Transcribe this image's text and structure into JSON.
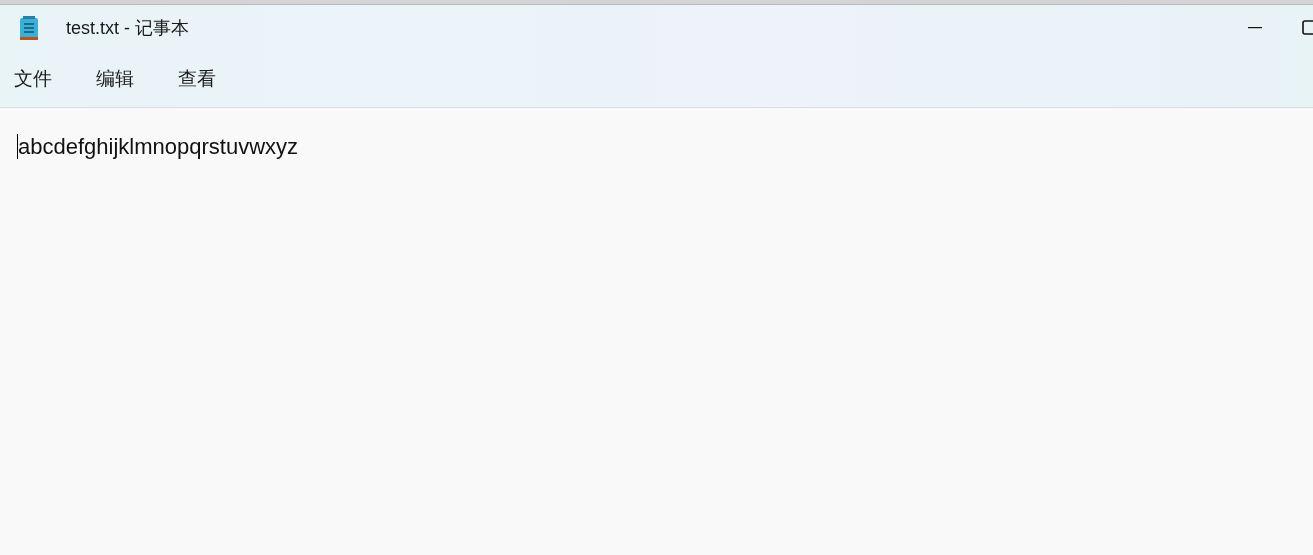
{
  "window": {
    "title": "test.txt - 记事本"
  },
  "menu": [
    {
      "label": "文件"
    },
    {
      "label": "编辑"
    },
    {
      "label": "查看"
    }
  ],
  "editor": {
    "text": "abcdefghijklmnopqrstuvwxyz"
  }
}
